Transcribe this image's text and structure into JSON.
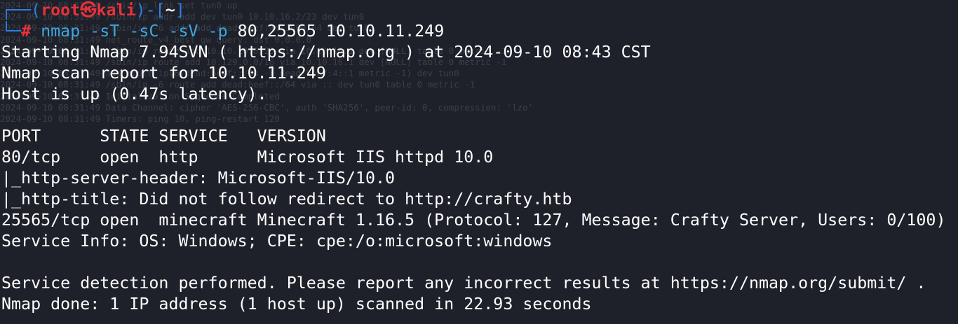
{
  "prompt": {
    "open": "┌──(",
    "user": "root㉿kali",
    "mid": ")-[",
    "cwd": "~",
    "close": "]",
    "corner": "└─",
    "symbol": "#"
  },
  "command": {
    "program": "nmap",
    "flags": "-sT -sC -sV -p",
    "args": "80,25565 10.10.11.249"
  },
  "output_lines": [
    "Starting Nmap 7.94SVN ( https://nmap.org ) at 2024-09-10 08:43 CST",
    "Nmap scan report for 10.10.11.249",
    "Host is up (0.47s latency).",
    "",
    "PORT      STATE SERVICE   VERSION",
    "80/tcp    open  http      Microsoft IIS httpd 10.0",
    "|_http-server-header: Microsoft-IIS/10.0",
    "|_http-title: Did not follow redirect to http://crafty.htb",
    "25565/tcp open  minecraft Minecraft 1.16.5 (Protocol: 127, Message: Crafty Server, Users: 0/100)",
    "Service Info: OS: Windows; CPE: cpe:/o:microsoft:windows",
    "",
    "Service detection performed. Please report any incorrect results at https://nmap.org/submit/ .",
    "Nmap done: 1 IP address (1 host up) scanned in 22.93 seconds"
  ],
  "background_log": [
    "2024-09-10 08:31:49 /sbin/ip link set tun0 up",
    "2024-09-10 08:31:49 /sbin/ip addr add dev tun0 10.10.16.2/23 dev tun0",
    "2024-09-10 08:31:49 /sbin/ip -6 addr add dead:beef:4::1000/64 dev tun0",
    "2024-09-10 08:31:49 net_route_v4_best_gw query: dst 0.0.0.0",
    "2024-09-10 08:31:49 /sbin/ip route add 10.10.10.0/23 via 10.10.16.1 dev [NULL] table 0 metric -1",
    "2024-09-10 08:31:49 /sbin/ip route add 10.129.0.0/16 via 10.10.16.1 dev [NULL] table 0 metric -1",
    "2024-09-10 08:31:49 add_route_ipv6(dead:beef::/64 -> dead:beef:4::1 metric -1) dev tun0",
    "2024-09-10 08:31:49 /sbin/ip -6 route add dead:beef::/64 via :: dev tun0 table 0 metric -1",
    "2024-09-10 08:31:49 Initialization Sequence Completed",
    "2024-09-10 08:31:49 Data Channel: cipher 'AES-256-CBC', auth 'SHA256', peer-id: 0, compression: 'lzo'",
    "2024-09-10 08:31:49 Timers: ping 10, ping-restart 120"
  ],
  "colors": {
    "background": "#1e2129",
    "prompt_frame": "#2f7fe6",
    "prompt_user": "#e8323c",
    "command": "#3fa7e2",
    "text": "#ffffff",
    "faint_log": "#3b3f48"
  }
}
